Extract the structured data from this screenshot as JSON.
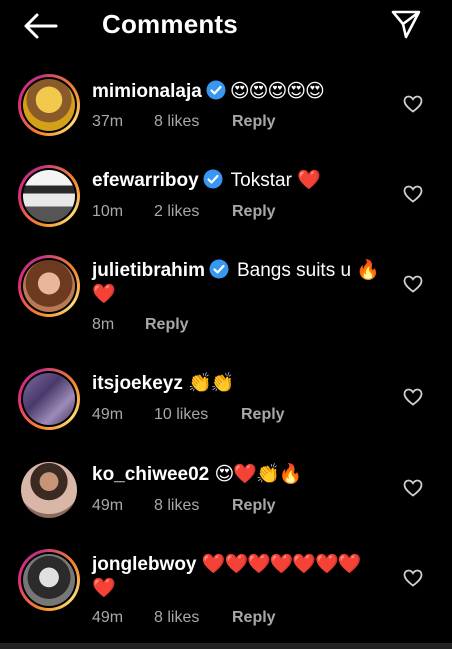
{
  "header": {
    "title": "Comments",
    "back_icon": "arrow-left-icon",
    "send_icon": "paper-plane-icon"
  },
  "comments": [
    {
      "username": "mimionalaja",
      "verified": true,
      "text": "",
      "emojis": "😍😍😍😍😍",
      "time": "37m",
      "likes": "8 likes",
      "reply": "Reply"
    },
    {
      "username": "efewarriboy",
      "verified": true,
      "text": "Tokstar",
      "emojis": "❤️",
      "time": "10m",
      "likes": "2 likes",
      "reply": "Reply"
    },
    {
      "username": "julietibrahim",
      "verified": true,
      "text": "Bangs suits u",
      "emojis": "🔥",
      "emojis_line2": "❤️",
      "time": "8m",
      "likes": "",
      "reply": "Reply"
    },
    {
      "username": "itsjoekeyz",
      "verified": false,
      "text": "",
      "emojis": "👏👏",
      "time": "49m",
      "likes": "10 likes",
      "reply": "Reply"
    },
    {
      "username": "ko_chiwee02",
      "verified": false,
      "text": "",
      "emojis": "😍❤️👏🔥",
      "time": "49m",
      "likes": "8 likes",
      "reply": "Reply"
    },
    {
      "username": "jonglebwoy",
      "verified": false,
      "text": "",
      "emojis": "❤️❤️❤️❤️❤️❤️❤️",
      "emojis_line2": "❤️",
      "time": "49m",
      "likes": "8 likes",
      "reply": "Reply"
    }
  ],
  "colors": {
    "background": "#000000",
    "meta_text": "#a8a8a8",
    "verified_badge": "#3897f0"
  }
}
